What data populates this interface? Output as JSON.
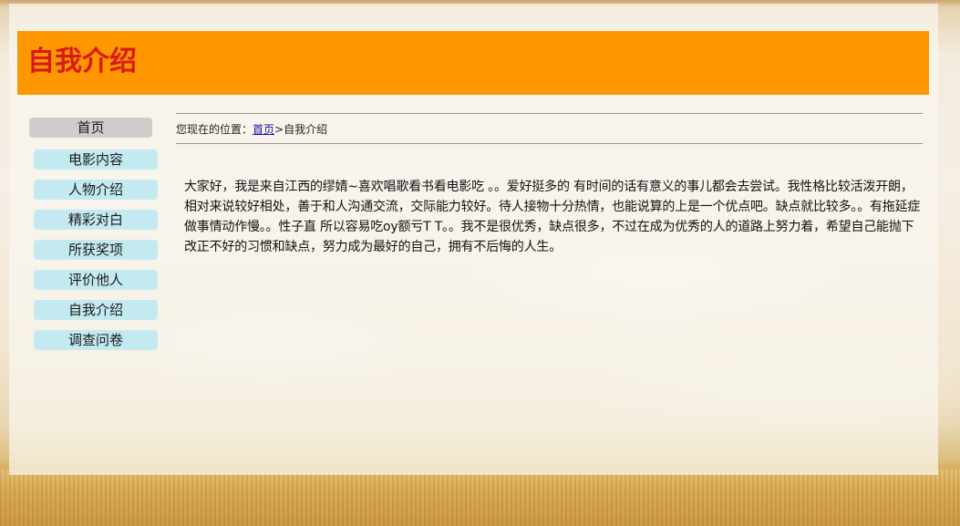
{
  "header": {
    "title": "自我介绍"
  },
  "nav": {
    "items": [
      {
        "label": "首页",
        "active": true
      },
      {
        "label": "电影内容",
        "active": false
      },
      {
        "label": "人物介绍",
        "active": false
      },
      {
        "label": "精彩对白",
        "active": false
      },
      {
        "label": "所获奖项",
        "active": false
      },
      {
        "label": "评价他人",
        "active": false
      },
      {
        "label": "自我介绍",
        "active": false
      },
      {
        "label": "调查问卷",
        "active": false
      }
    ]
  },
  "breadcrumb": {
    "prefix": "您现在的位置：",
    "home_link": "首页",
    "separator": ">",
    "current": "自我介绍"
  },
  "main": {
    "intro_text": "大家好，我是来自江西的缪婧~喜欢唱歌看书看电影吃 。。爱好挺多的 有时间的话有意义的事儿都会去尝试。我性格比较活泼开朗，相对来说较好相处，善于和人沟通交流，交际能力较好。待人接物十分热情，也能说算的上是一个优点吧。缺点就比较多。。有拖延症 做事情动作慢。。性子直 所以容易吃oy额亏T T。。我不是很优秀，缺点很多，不过在成为优秀的人的道路上努力着，希望自己能抛下改正不好的习惯和缺点，努力成为最好的自己，拥有不后悔的人生。"
  },
  "colors": {
    "header_bg": "#ff9800",
    "title_color": "#d81a1a",
    "nav_bg": "#c4eaf1",
    "nav_active_bg": "#cfcdcb",
    "link_color": "#1a0dab"
  }
}
